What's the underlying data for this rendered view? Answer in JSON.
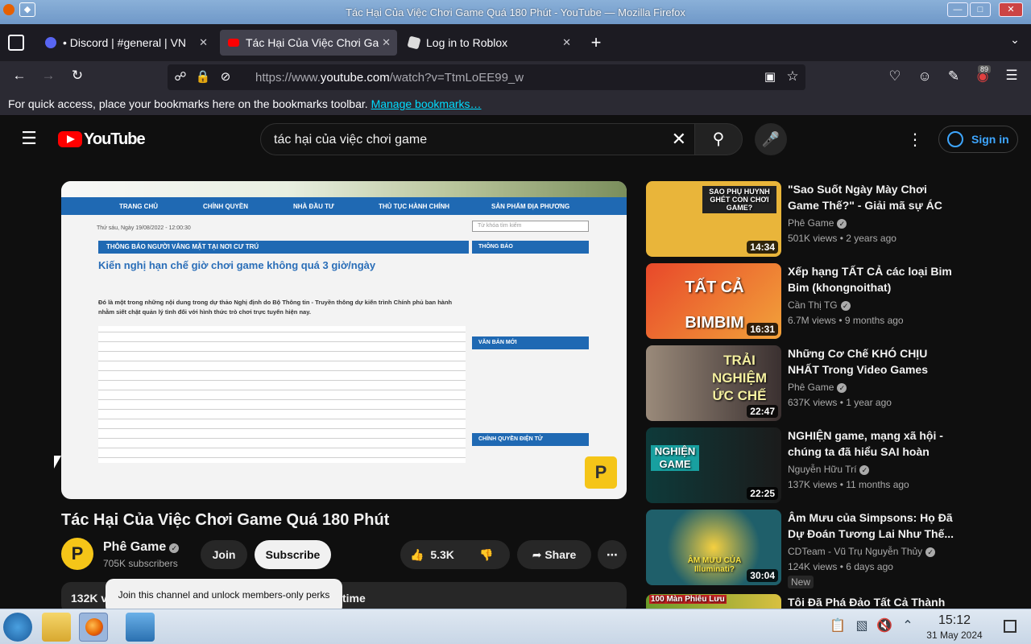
{
  "window": {
    "title": "Tác Hại Của Việc Chơi Game Quá 180 Phút - YouTube — Mozilla Firefox",
    "min": "—",
    "max": "□",
    "close": "✕"
  },
  "tabs": [
    {
      "label": "• Discord | #general | VN",
      "close": "✕"
    },
    {
      "label": "Tác Hại Của Việc Chơi Game",
      "close": "✕"
    },
    {
      "label": "Log in to Roblox",
      "close": "✕"
    }
  ],
  "new_tab": "+",
  "nav": {
    "url_prefix": "https://www.",
    "url_domain": "youtube.com",
    "url_path": "/watch?v=TtmLoEE99_w",
    "badge": "89"
  },
  "bookmarks": {
    "text": "For quick access, place your bookmarks here on the bookmarks toolbar.",
    "link": "Manage bookmarks…"
  },
  "youtube": {
    "logo": "YouTube",
    "search_value": "tác hại của việc chơi game",
    "sign_in": "Sign in"
  },
  "player_page": {
    "menu": [
      "TRANG CHỦ",
      "CHÍNH QUYỀN",
      "NHÀ ĐẦU TƯ",
      "THỦ TỤC HÀNH CHÍNH",
      "SẢN PHẨM ĐỊA PHƯƠNG"
    ],
    "date": "Thứ sáu, Ngày 19/08/2022 - 12:00:30",
    "section": "THÔNG BÁO NGƯỜI VẮNG MẶT TẠI NƠI CƯ TRÚ",
    "headline": "Kiến nghị hạn chế giờ chơi game không quá 3 giờ/ngày",
    "lead": "Đó là một trong những nội dung trong dự thảo Nghị định do Bộ Thông tin - Truyền thông dự kiến trình Chính phủ ban hành nhằm siết chặt quản lý tình đối với hình thức trò chơi trực tuyến hiện nay.",
    "side1": "THÔNG BÁO",
    "side2": "VĂN BẢN MỚI",
    "side3": "CHÍNH QUYỀN ĐIỆN TỬ",
    "search_ph": "Từ khóa tìm kiếm"
  },
  "video": {
    "title": "Tác Hại Của Việc Chơi Game Quá 180 Phút",
    "channel": "Phê Game",
    "subs": "705K subscribers",
    "join": "Join",
    "subscribe": "Subscribe",
    "likes": "5.3K",
    "share": "Share",
    "desc_start": "132K v",
    "desc_end": "time",
    "tooltip": "Join this channel and unlock members-only perks"
  },
  "related": [
    {
      "title": "\"Sao Suốt Ngày Mày Chơi Game Thế?\" - Giải mã sự ÁC CẢM cú...",
      "channel": "Phê Game",
      "meta": "501K views • 2 years ago",
      "duration": "14:34",
      "thumb_text": "SAO PHỤ HUYNH GHÉT CON CHƠI GAME?",
      "color": "#e9b53a"
    },
    {
      "title": "Xếp hạng TẤT CẢ các loại Bim Bim (khongnoithat)",
      "channel": "Cần Thị TG",
      "meta": "6.7M views • 9 months ago",
      "duration": "16:31",
      "thumb_text": "TẤT CẢ BIMBIM",
      "color": "#d9572a"
    },
    {
      "title": "Những Cơ Chế KHÓ CHỊU NHẤT Trong Video Games",
      "channel": "Phê Game",
      "meta": "637K views • 1 year ago",
      "duration": "22:47",
      "thumb_text": "TRẢI NGHIỆM ỨC CHẾ",
      "color": "#7a6a5c"
    },
    {
      "title": "NGHIỆN game, mạng xã hội - chúng ta đã hiểu SAI hoàn toà...",
      "channel": "Nguyễn Hữu Trí",
      "meta": "137K views • 11 months ago",
      "duration": "22:25",
      "thumb_text": "NGHIỆN GAME",
      "color": "#1f3b3a"
    },
    {
      "title": "Âm Mưu của Simpsons: Họ Đã Dự Đoán Tương Lai Như Thế...",
      "channel": "CDTeam - Vũ Trụ Nguyễn Thủy",
      "meta": "124K views • 6 days ago",
      "duration": "30:04",
      "thumb_text": "ÂM MƯU CỦA Illuminati?",
      "color": "#1f5f6a",
      "badge": "New"
    },
    {
      "title": "Tôi Đã Phá Đảo Tất Cả Thành",
      "channel": "",
      "meta": "",
      "duration": "",
      "thumb_text": "100 Màn Phiêu Lưu",
      "color": "#6a9a2a"
    }
  ],
  "taskbar": {
    "time": "15:12",
    "date": "31 May 2024"
  }
}
